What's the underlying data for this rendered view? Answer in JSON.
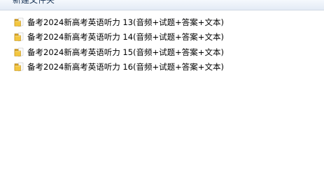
{
  "toolbar": {
    "new_folder_label": "新建文件夹"
  },
  "files": [
    {
      "name": "备考2024新高考英语听力 13(音频+试题+答案+文本)",
      "icon": "folder-icon"
    },
    {
      "name": "备考2024新高考英语听力 14(音频+试题+答案+文本)",
      "icon": "folder-icon"
    },
    {
      "name": "备考2024新高考英语听力 15(音频+试题+答案+文本)",
      "icon": "folder-icon"
    },
    {
      "name": "备考2024新高考英语听力 16(音频+试题+答案+文本)",
      "icon": "folder-icon"
    }
  ]
}
